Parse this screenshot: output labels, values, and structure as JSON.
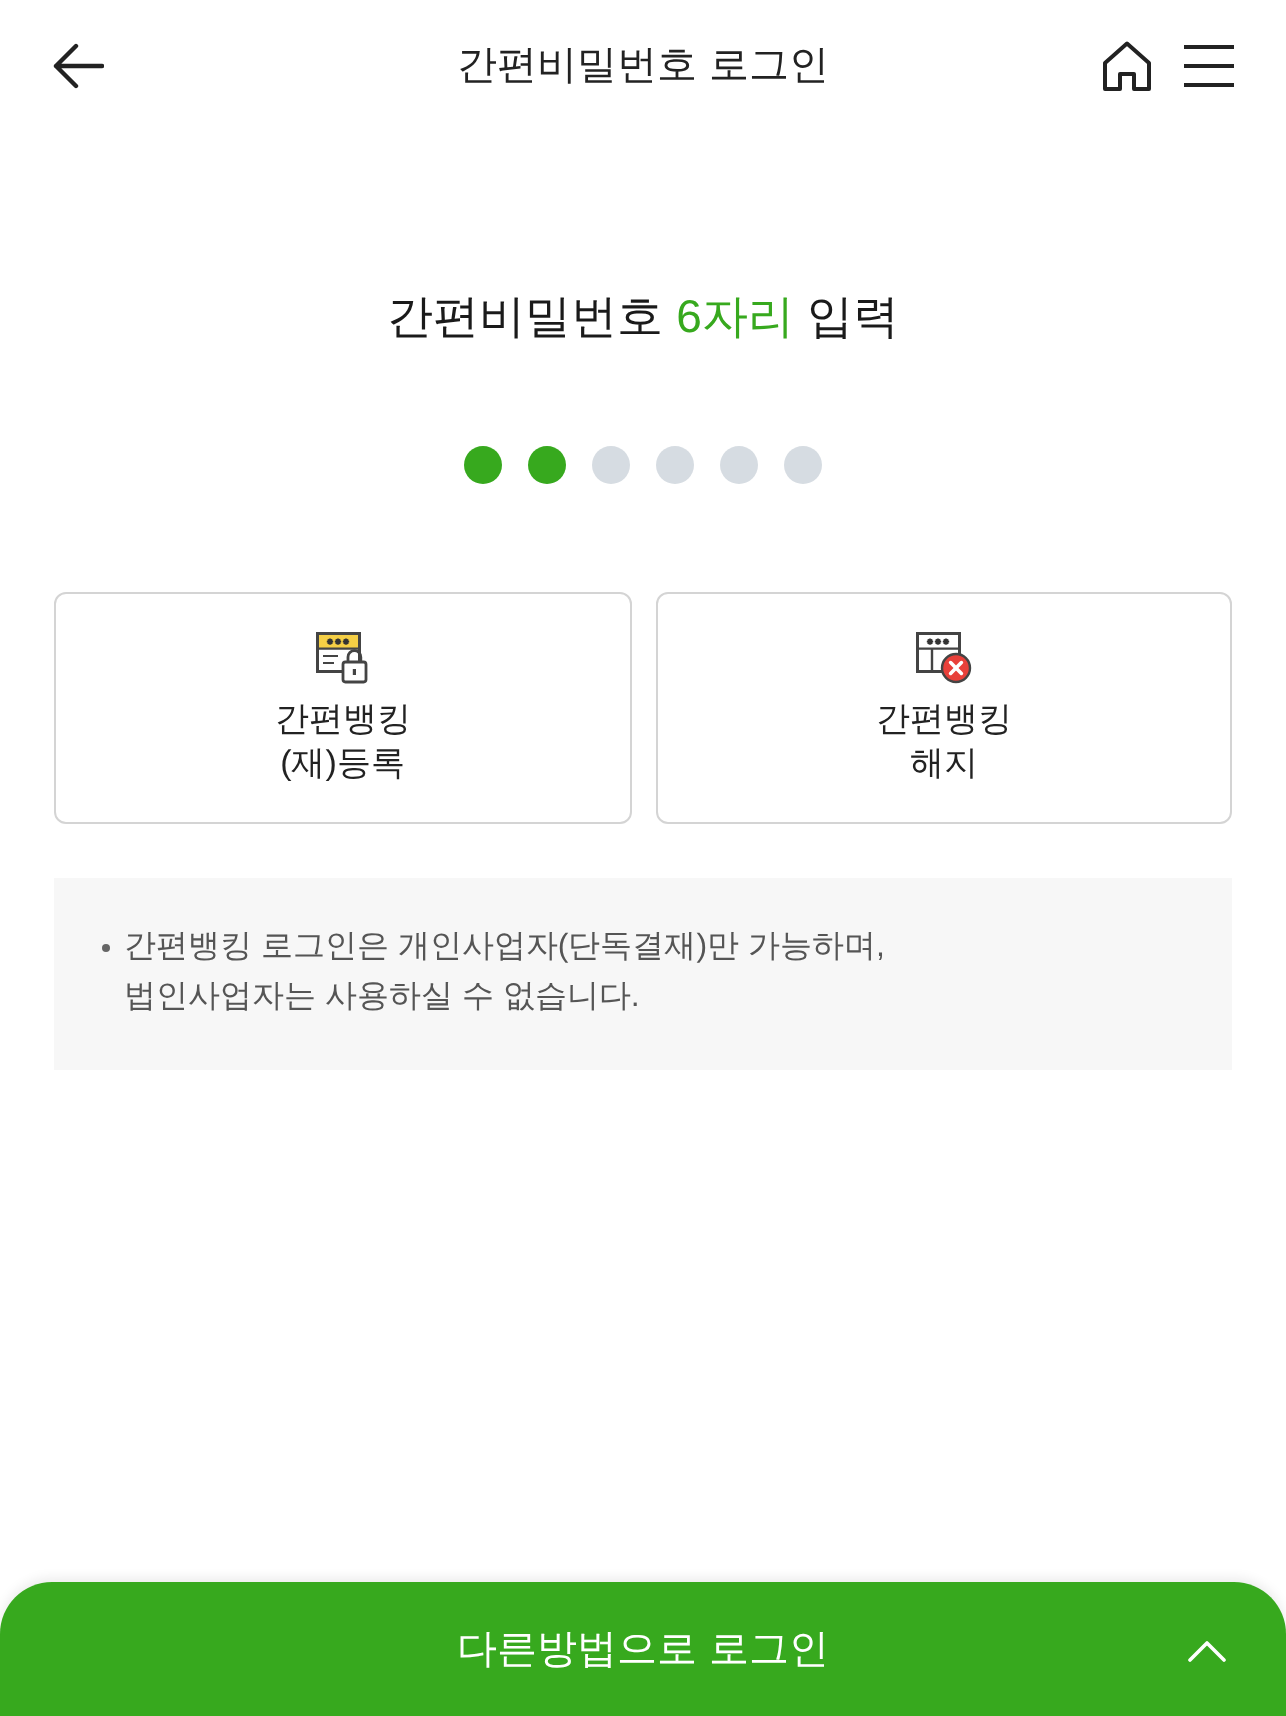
{
  "header": {
    "title": "간편비밀번호 로그인"
  },
  "prompt": {
    "parts": [
      {
        "text": "간편비밀번호 ",
        "accent": false
      },
      {
        "text": "6자리",
        "accent": true
      },
      {
        "text": " 입력",
        "accent": false
      }
    ]
  },
  "pin_dots": [
    {
      "filled": true
    },
    {
      "filled": true
    },
    {
      "filled": false
    },
    {
      "filled": false
    },
    {
      "filled": false
    },
    {
      "filled": false
    }
  ],
  "options": [
    {
      "kind": "register",
      "label": "간편뱅킹\n(재)등록"
    },
    {
      "kind": "cancel",
      "label": "간편뱅킹\n해지"
    }
  ],
  "notice": {
    "items": [
      "간편뱅킹 로그인은 개인사업자(단독결재)만 가능하며,\n법인사업자는 사용하실 수 없습니다."
    ]
  },
  "bottom_bar": {
    "label": "다른방법으로 로그인"
  }
}
